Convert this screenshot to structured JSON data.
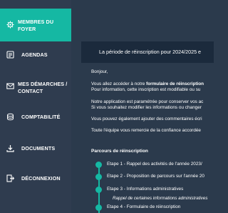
{
  "sidebar": {
    "items": [
      {
        "label": "MEMBRES DU FOYER",
        "icon": "people-gear-icon",
        "active": true
      },
      {
        "label": "AGENDAS",
        "icon": "calendar-list-icon"
      },
      {
        "label": "MES DÉMARCHES / CONTACT",
        "icon": "envelope-icon"
      },
      {
        "label": "COMPTABILITÉ",
        "icon": "coins-icon"
      },
      {
        "label": "DOCUMENTS",
        "icon": "download-icon"
      },
      {
        "label": "DÉCONNEXION",
        "icon": "logout-icon"
      }
    ]
  },
  "main": {
    "banner": "La période de réinscription pour 2024/2025 e",
    "greeting": "Bonjour,",
    "para1_prefix": "Vous allez accéder à notre ",
    "para1_bold": "formulaire de réinscription",
    "para1_line2": "Pour information, cette inscription est modifiable ou su",
    "para2_line1": "Notre application est paramétrée pour conserver vos ac",
    "para2_line2": "Si vous souhaitez modifier les informations ou changer",
    "para3": "Vous pouvez également ajouter des commentaires écri",
    "para4": "Toute l'équipe vous remercie de la confiance accordée",
    "section_title": "Parcours de réinscription",
    "steps": [
      {
        "label": "Etape 1 - Rappel des activités de l'année 2023/"
      },
      {
        "label": "Etape 2 - Proposition de parcours sur l'année 20"
      },
      {
        "label": "Etape 3 - Informations administratives"
      },
      {
        "label": "Etape 4 - Formulaire de réinscription"
      }
    ],
    "substep": "Rappel de certaines informations administratives"
  },
  "colors": {
    "accent": "#15b8a3",
    "sidebar_bg": "#2f3c4f",
    "main_bg": "#2b3a4c",
    "banner_bg": "#1b2a3c"
  }
}
